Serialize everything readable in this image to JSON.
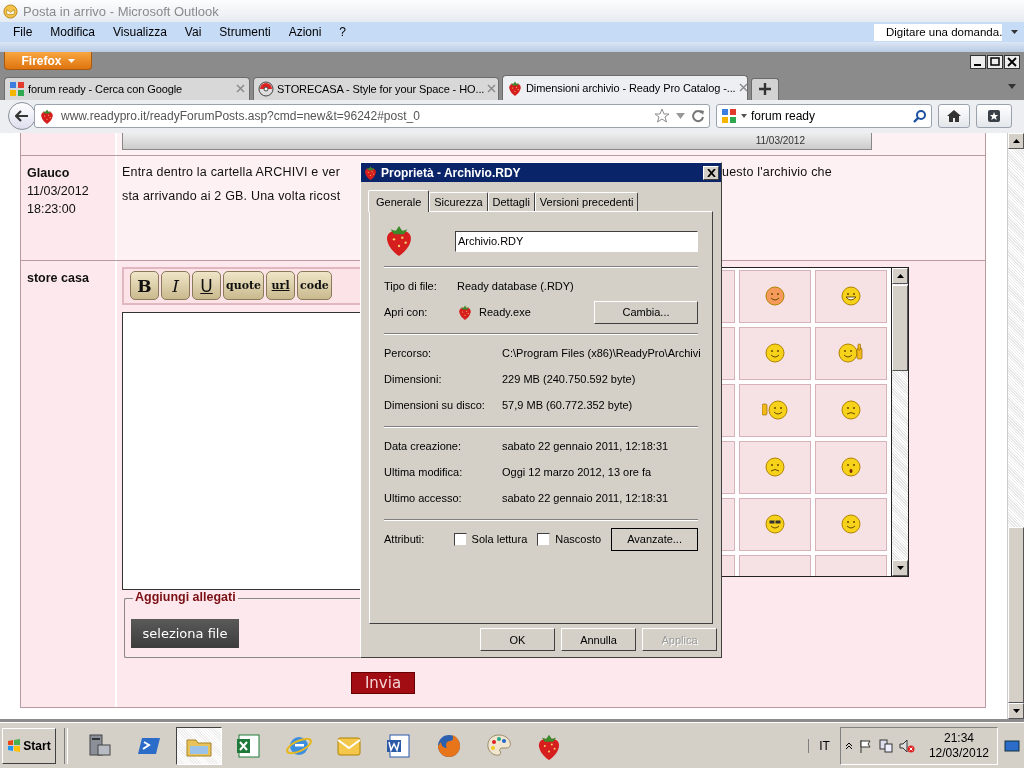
{
  "outlook": {
    "title": "Posta in arrivo - Microsoft Outlook",
    "menu": [
      "File",
      "Modifica",
      "Visualizza",
      "Vai",
      "Strumenti",
      "Azioni",
      "?"
    ],
    "help_search": {
      "placeholder": "Digitare una domanda."
    }
  },
  "firefox": {
    "menu_button": "Firefox",
    "tabs": [
      {
        "label": "forum ready - Cerca con Google",
        "selected": false,
        "kind": "google"
      },
      {
        "label": "STORECASA - Style for your Space - HO...",
        "selected": false,
        "kind": "storecasa"
      },
      {
        "label": "Dimensioni archivio - Ready Pro Catalog -...",
        "selected": true,
        "kind": "strawberry"
      }
    ],
    "address": "www.readypro.it/readyForumPosts.asp?cmd=new&t=96242#post_0",
    "search": "forum ready"
  },
  "forum": {
    "strip_date": "11/03/2012",
    "post": {
      "author": "Glauco",
      "date": "11/03/2012",
      "time": "18:23:00",
      "text_left": [
        "Entra dentro la cartella ARCHIVI e ver",
        "sta arrivando ai 2 GB. Una volta ricost"
      ],
      "text_right": [
        "uesto l'archivio che"
      ]
    },
    "reply": {
      "author": "store casa",
      "format_buttons": [
        "B",
        "I",
        "U",
        "quote",
        "url",
        "code"
      ],
      "attachments_legend": "Aggiungi allegati",
      "select_file": "seleziona file",
      "send": "Invia"
    }
  },
  "dialog": {
    "title": "Proprietà - Archivio.RDY",
    "tabs": [
      {
        "label": "Generale",
        "selected": true
      },
      {
        "label": "Sicurezza",
        "selected": false
      },
      {
        "label": "Dettagli",
        "selected": false
      },
      {
        "label": "Versioni precedenti",
        "selected": false
      }
    ],
    "filename": "Archivio.RDY",
    "groups": [
      [
        {
          "label": "Tipo di file:",
          "value": "Ready database (.RDY)"
        },
        {
          "label": "Apri con:",
          "value": "Ready.exe",
          "button": "Cambia..."
        }
      ],
      [
        {
          "label": "Percorso:",
          "value": "C:\\Program Files (x86)\\ReadyPro\\Archivi"
        },
        {
          "label": "Dimensioni:",
          "value": "229 MB (240.750.592 byte)"
        },
        {
          "label": "Dimensioni su disco:",
          "value": "57,9 MB (60.772.352 byte)"
        }
      ],
      [
        {
          "label": "Data creazione:",
          "value": "sabato 22 gennaio 2011, 12:18:31"
        },
        {
          "label": "Ultima modifica:",
          "value": "Oggi 12 marzo 2012, 13 ore fa"
        },
        {
          "label": "Ultimo accesso:",
          "value": "sabato 22 gennaio 2011, 12:18:31"
        }
      ]
    ],
    "attributes": {
      "label": "Attributi:",
      "checks": [
        {
          "label": "Sola lettura",
          "checked": false
        },
        {
          "label": "Nascosto",
          "checked": false
        }
      ],
      "button": "Avanzate..."
    },
    "buttons": [
      {
        "label": "OK",
        "disabled": false
      },
      {
        "label": "Annulla",
        "disabled": false
      },
      {
        "label": "Applica",
        "disabled": true
      }
    ]
  },
  "taskbar": {
    "start": "Start",
    "apps": [
      {
        "kind": "server",
        "selected": false
      },
      {
        "kind": "powershell",
        "selected": false
      },
      {
        "kind": "explorer",
        "selected": true
      },
      {
        "kind": "excel",
        "selected": false
      },
      {
        "kind": "ie",
        "selected": false
      },
      {
        "kind": "outlook",
        "selected": false
      },
      {
        "kind": "word",
        "selected": false
      },
      {
        "kind": "firefox",
        "selected": false
      },
      {
        "kind": "paint",
        "selected": false
      },
      {
        "kind": "strawberry",
        "selected": false
      }
    ],
    "language": "IT",
    "time": "21:34",
    "date": "12/03/2012"
  }
}
